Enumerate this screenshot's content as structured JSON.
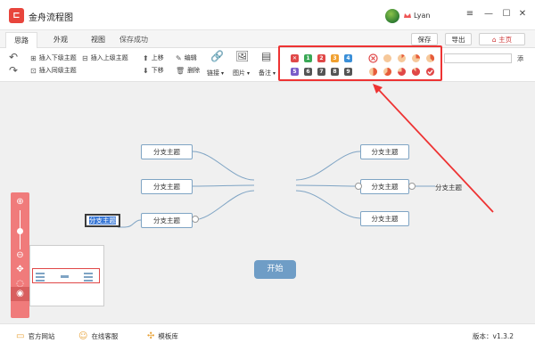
{
  "app": {
    "title": "金舟流程图",
    "user": "Lyan",
    "window_controls": [
      "≡",
      "—",
      "☐",
      "✕"
    ]
  },
  "tabs": [
    {
      "label": "思路",
      "active": true
    },
    {
      "label": "外观",
      "active": false
    },
    {
      "label": "视图",
      "active": false
    }
  ],
  "save_status": "保存成功",
  "header_buttons": {
    "save": "保存",
    "export": "导出",
    "home": "主页"
  },
  "ribbon": {
    "insert_child": "插入下级主题",
    "insert_parent": "插入上级主题",
    "insert_sibling": "插入同级主题",
    "move_up": "上移",
    "move_down": "下移",
    "edit": "编辑",
    "delete": "删除",
    "link": "链接",
    "image": "图片",
    "note": "备注",
    "add_partial": "添"
  },
  "markers": {
    "priority_row1": [
      {
        "label": "✕",
        "color": "#e04848"
      },
      {
        "label": "1",
        "color": "#3aa856"
      },
      {
        "label": "2",
        "color": "#e04848"
      },
      {
        "label": "3",
        "color": "#f0a030"
      },
      {
        "label": "4",
        "color": "#3a8fd8"
      }
    ],
    "priority_row2": [
      {
        "label": "5",
        "color": "#7a5cc8"
      },
      {
        "label": "6",
        "color": "#555555"
      },
      {
        "label": "7",
        "color": "#555555"
      },
      {
        "label": "8",
        "color": "#555555"
      },
      {
        "label": "9",
        "color": "#555555"
      }
    ],
    "progress_row1": [
      {
        "label": "cancel-icon",
        "color": "#e04848"
      },
      {
        "label": "progress-0",
        "color": "#f3b37a"
      },
      {
        "label": "progress-12",
        "color": "#f3b37a"
      },
      {
        "label": "progress-25",
        "color": "#f3b37a"
      },
      {
        "label": "progress-37",
        "color": "#f3b37a"
      }
    ],
    "progress_row2": [
      {
        "label": "progress-50",
        "color": "#f0a030"
      },
      {
        "label": "progress-62",
        "color": "#e65c3a"
      },
      {
        "label": "progress-75",
        "color": "#e04848"
      },
      {
        "label": "progress-87",
        "color": "#e04848"
      },
      {
        "label": "done-icon",
        "color": "#e04848"
      }
    ]
  },
  "mindmap": {
    "root": "开始",
    "left_branches": [
      "分支主题",
      "分支主题",
      "分支主题"
    ],
    "right_branches": [
      "分支主题",
      "分支主题",
      "分支主题"
    ],
    "sub_right": "分支主题",
    "editing_text": "分支主题"
  },
  "statusbar": {
    "website": "官方网站",
    "support": "在线客服",
    "templates": "模板库",
    "version": "版本：v1.3.2"
  },
  "colors": {
    "accent": "#e33333",
    "node_border": "#7fa4c4",
    "root_fill": "#6f9dc6",
    "sidebar": "#f07b7b"
  }
}
